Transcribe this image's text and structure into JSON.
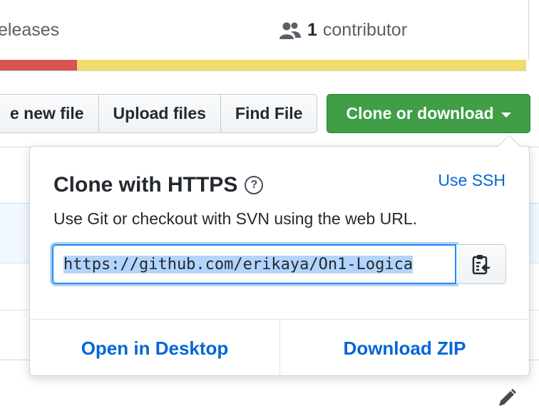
{
  "summary": {
    "releases_label": "eleases",
    "contributor_count": "1",
    "contributor_label": "contributor",
    "icon": "people-icon"
  },
  "language_bar": [
    {
      "color": "#d9534f",
      "fraction": 0.15
    },
    {
      "color": "#f0dc6b",
      "fraction": 0.85
    }
  ],
  "toolbar": {
    "create_label": "e new file",
    "upload_label": "Upload files",
    "find_label": "Find File",
    "clone_label": "Clone or download"
  },
  "popover": {
    "title": "Clone with HTTPS",
    "help_icon": "question-circle-icon",
    "use_ssh_label": "Use SSH",
    "description": "Use Git or checkout with SVN using the web URL.",
    "url_value": "https://github.com/erikaya/On1-Logica",
    "copy_icon": "clipboard-icon",
    "open_desktop_label": "Open in Desktop",
    "download_zip_label": "Download ZIP"
  },
  "colors": {
    "accent_green": "#3f9e46",
    "link_blue": "#0366d6"
  },
  "edit_icon": "pencil-icon"
}
